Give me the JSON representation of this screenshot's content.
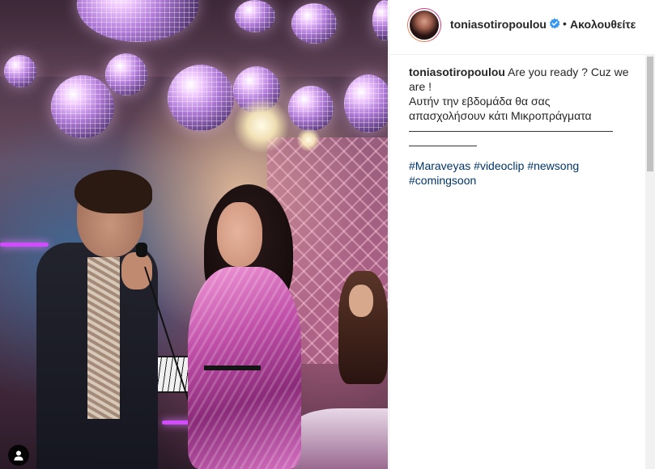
{
  "post": {
    "username": "toniasotiropoulou",
    "separator": "•",
    "follow_label": "Ακολουθείτε",
    "caption": {
      "author": "toniasotiropoulou",
      "lines": [
        "Are you ready ? Cuz we",
        "are !",
        "Αυτήν την εβδομάδα θα σας",
        "απασχολήσουν κάτι Μικροπράγματα",
        "——————————————————",
        "——————"
      ],
      "hashtags": [
        "#Maraveyas",
        "#videoclip",
        "#newsong",
        "#comingsoon"
      ]
    }
  },
  "icons": {
    "verified": "verified-badge-icon",
    "tagged_user": "user-tag-icon"
  },
  "colors": {
    "verified_blue": "#3897f0",
    "hashtag_link": "#003569",
    "story_ring": [
      "#f9a13a",
      "#e4405f",
      "#b42ea5"
    ]
  }
}
